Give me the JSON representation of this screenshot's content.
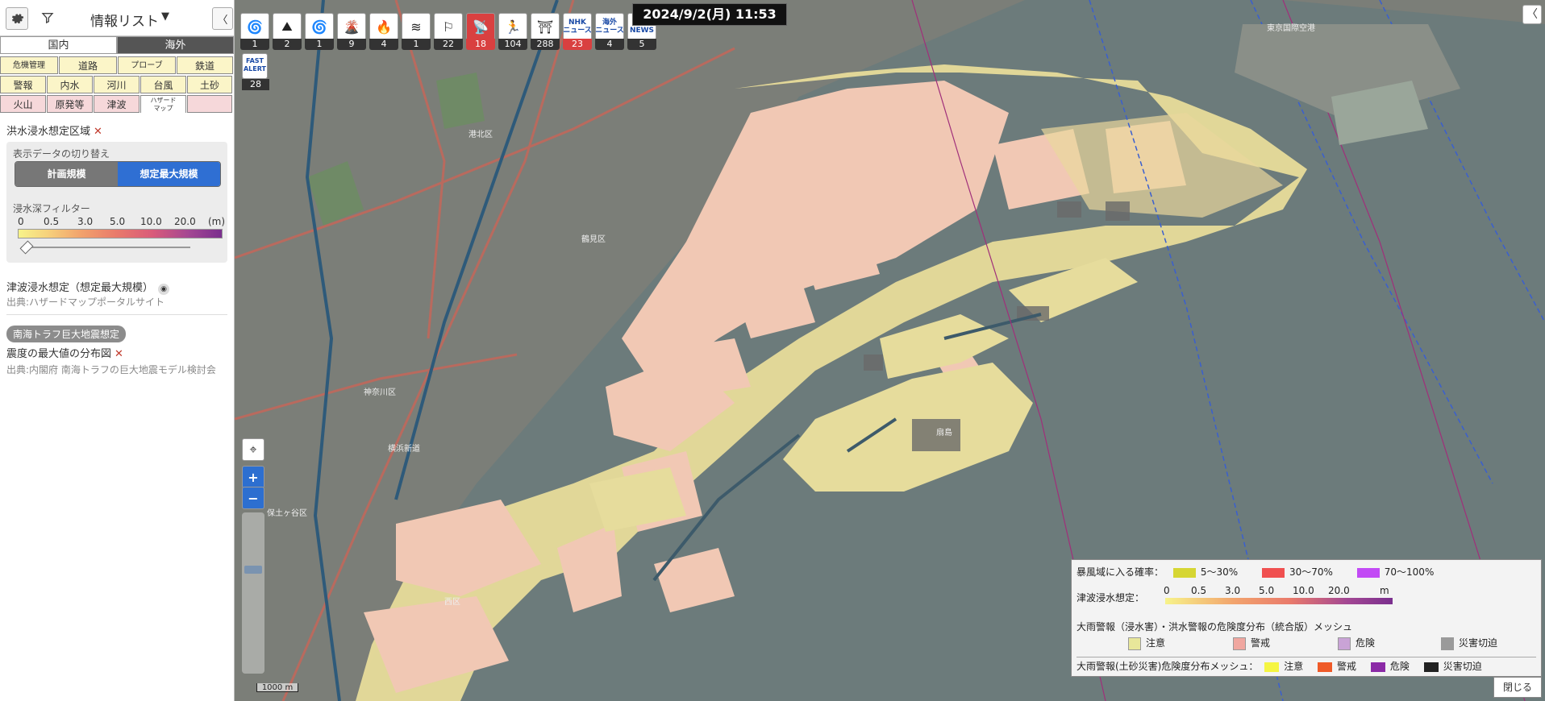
{
  "panel": {
    "title": "情報リスト",
    "dropdown": "▼",
    "collapse": "〈",
    "region_tabs": [
      {
        "label": "国内"
      },
      {
        "label": "海外"
      }
    ],
    "categories_row1": [
      "危機管理",
      "道路",
      "プローブ",
      "鉄道"
    ],
    "categories_row2": [
      "警報",
      "内水",
      "河川",
      "台風",
      "土砂"
    ],
    "categories_row3": [
      "火山",
      "原発等",
      "津波",
      "ハザード\nマップ",
      ""
    ],
    "flood_title": "洪水浸水想定区域",
    "switch_label": "表示データの切り替え",
    "switch_options": [
      "計画規模",
      "想定最大規模"
    ],
    "depth_filter_label": "浸水深フィルター",
    "depth_unit": "(m)",
    "depth_values": [
      "0",
      "0.5",
      "3.0",
      "5.0",
      "10.0",
      "20.0"
    ],
    "tsunami_title": "津波浸水想定（想定最大規模）",
    "tsunami_source": "出典:ハザードマップポータルサイト",
    "nankai_badge": "南海トラフ巨大地震想定",
    "seismic_title": "震度の最大値の分布図",
    "seismic_source": "出典:内閣府 南海トラフの巨大地震モデル検討会"
  },
  "toolbar": {
    "tools": [
      {
        "icon": "typhoon-icon",
        "count": "1"
      },
      {
        "icon": "landslide-icon",
        "count": "2"
      },
      {
        "icon": "typhoon-icon",
        "count": "1"
      },
      {
        "icon": "volcano-icon",
        "count": "9"
      },
      {
        "icon": "fire-icon",
        "count": "4"
      },
      {
        "icon": "wind-icon",
        "count": "1"
      },
      {
        "icon": "water-level-icon",
        "count": "22"
      },
      {
        "icon": "antenna-icon",
        "count": "18"
      },
      {
        "icon": "evacuation-icon",
        "count": "104"
      },
      {
        "icon": "closure-icon",
        "count": "288"
      },
      {
        "icon": "nhk-news-icon",
        "count": "23",
        "text": "NHK\nニュース"
      },
      {
        "icon": "overseas-news-icon",
        "count": "4",
        "text": "海外\nニュース"
      },
      {
        "icon": "nhk-world-icon",
        "count": "5",
        "text": "NHK\nNEWS"
      }
    ],
    "fast_alert_label": "FAST\nALERT",
    "fast_alert_count": "28"
  },
  "datetime": "2024/9/2(月)  11:53",
  "map": {
    "scale": "1000 m"
  },
  "legend": {
    "storm_title": "暴風域に入る確率：",
    "storm_items": [
      {
        "label": "5〜30%",
        "color": "#d6d633"
      },
      {
        "label": "30〜70%",
        "color": "#f05050"
      },
      {
        "label": "70〜100%",
        "color": "#c24af5"
      }
    ],
    "tsunami_label": "津波浸水想定：",
    "tsunami_ticks": [
      "0",
      "0.5",
      "3.0",
      "5.0",
      "10.0",
      "20.0",
      "m"
    ],
    "rain_title": "大雨警報（浸水害）・洪水警報の危険度分布（統合版）メッシュ",
    "rain_items": [
      {
        "label": "注意",
        "color": "#e8e79a"
      },
      {
        "label": "警戒",
        "color": "#f0a7a0"
      },
      {
        "label": "危険",
        "color": "#c9a3d6"
      },
      {
        "label": "災害切迫",
        "color": "#9a9a9a"
      }
    ],
    "landslide_title": "大雨警報(土砂災害)危険度分布メッシュ：",
    "landslide_items": [
      {
        "label": "注意",
        "color": "#f5f542"
      },
      {
        "label": "警戒",
        "color": "#ef5a28"
      },
      {
        "label": "危険",
        "color": "#8b2aa6"
      },
      {
        "label": "災害切迫",
        "color": "#222222"
      }
    ],
    "close_label": "閉じる"
  }
}
